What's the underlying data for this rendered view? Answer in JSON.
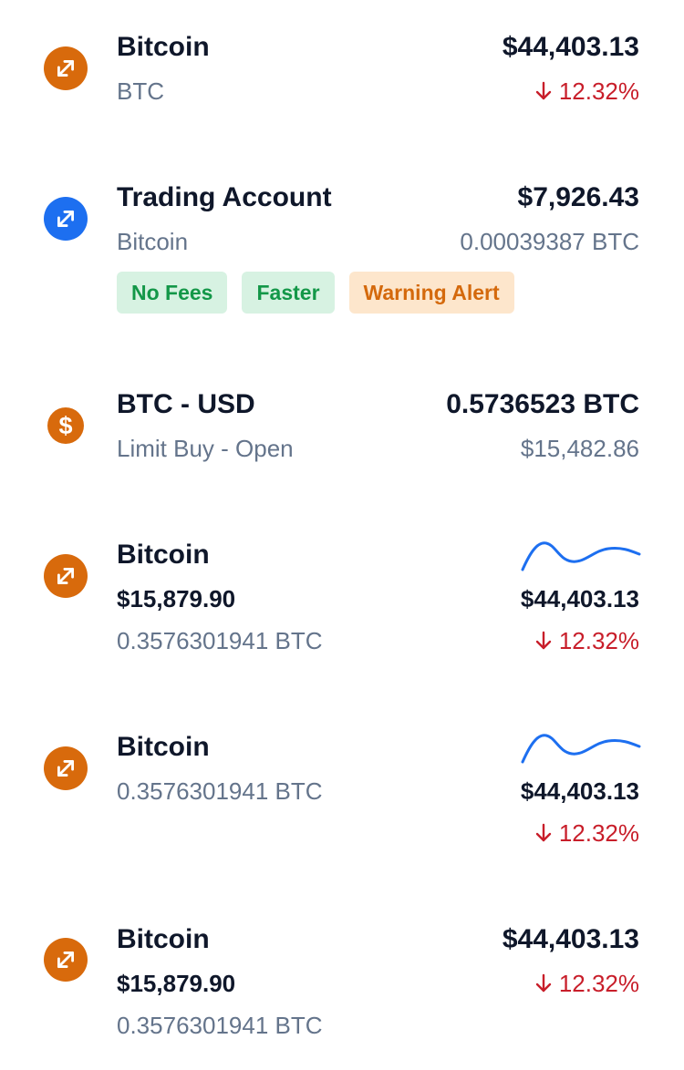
{
  "colors": {
    "accent_orange": "#d86a0c",
    "accent_blue": "#1d6ff0",
    "negative_red": "#c81e2a",
    "muted_text": "#64748b",
    "sparkline_blue": "#1d6ff0"
  },
  "items": [
    {
      "icon": "swap-arrows-icon",
      "name": "Bitcoin",
      "symbol": "BTC",
      "price": "$44,403.13",
      "change": "12.32%",
      "change_direction": "down"
    },
    {
      "icon": "swap-arrows-icon",
      "name": "Trading Account",
      "asset": "Bitcoin",
      "balance_usd": "$7,926.43",
      "balance_crypto": "0.00039387 BTC",
      "tags": [
        "No Fees",
        "Faster",
        "Warning Alert"
      ]
    },
    {
      "icon": "dollar-icon",
      "pair": "BTC - USD",
      "order_status": "Limit Buy - Open",
      "amount_crypto": "0.5736523 BTC",
      "amount_usd": "$15,482.86"
    },
    {
      "icon": "swap-arrows-icon",
      "name": "Bitcoin",
      "holding_value": "$15,879.90",
      "holding_amount": "0.3576301941 BTC",
      "price": "$44,403.13",
      "change": "12.32%",
      "change_direction": "down",
      "has_sparkline": true
    },
    {
      "icon": "swap-arrows-icon",
      "name": "Bitcoin",
      "holding_amount": "0.3576301941 BTC",
      "price": "$44,403.13",
      "change": "12.32%",
      "change_direction": "down",
      "has_sparkline": true
    },
    {
      "icon": "swap-arrows-icon",
      "name": "Bitcoin",
      "holding_value": "$15,879.90",
      "holding_amount": "0.3576301941 BTC",
      "price": "$44,403.13",
      "change": "12.32%",
      "change_direction": "down"
    }
  ]
}
